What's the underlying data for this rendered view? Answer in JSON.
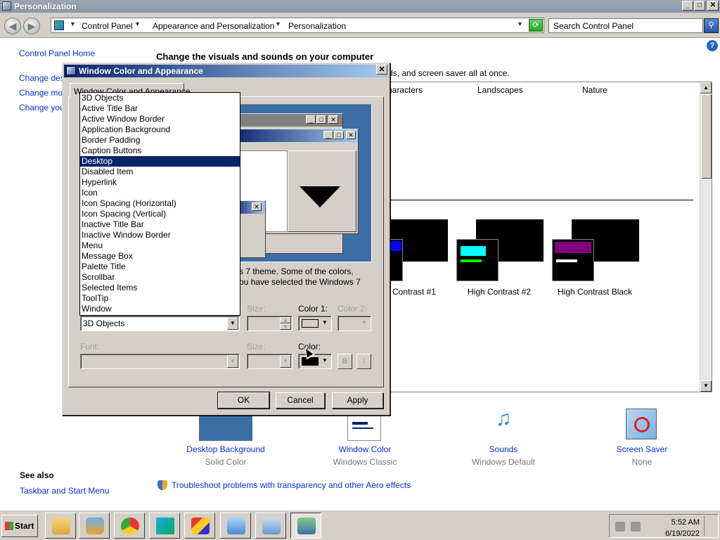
{
  "window": {
    "title": "Personalization",
    "min": "_",
    "max": "□",
    "close": "✕"
  },
  "address": {
    "crumbs": [
      "Control Panel",
      "Appearance and Personalization",
      "Personalization"
    ],
    "back": "◀",
    "forward": "▶",
    "search_placeholder": "Search Control Panel"
  },
  "left_nav": {
    "home": "Control Panel Home",
    "links": [
      "Change desk",
      "Change mou",
      "Change your"
    ]
  },
  "main": {
    "heading": "Change the visuals and sounds on your computer",
    "subheading": "ds, and screen saver all at once.",
    "help": "?"
  },
  "themes": {
    "categories": [
      "haracters",
      "Landscapes",
      "Nature"
    ],
    "items": [
      {
        "label": "Contrast #1",
        "accent": "#0000ff",
        "bar2": ""
      },
      {
        "label": "High Contrast #2",
        "accent": "#00ffff",
        "bar2": "#00ff00"
      },
      {
        "label": "High Contrast Black",
        "accent": "#800080",
        "bar2": "#ffffff"
      }
    ]
  },
  "bottom": {
    "items": [
      {
        "label": "Desktop Background",
        "sub": "Solid Color"
      },
      {
        "label": "Window Color",
        "sub": "Windows Classic"
      },
      {
        "label": "Sounds",
        "sub": "Windows Default"
      },
      {
        "label": "Screen Saver",
        "sub": "None"
      }
    ],
    "see_also": "See also",
    "taskbar_link": "Taskbar and Start Menu",
    "troubleshoot": "Troubleshoot problems with transparency and other Aero effects"
  },
  "dialog": {
    "title": "Window Color and Appearance",
    "close": "✕",
    "tab": "Window Color and Appearance",
    "desc_line1": "s 7 theme.  Some of the colors,",
    "desc_line2": "ou have selected the Windows 7",
    "item_value": "3D Objects",
    "size_label": "Size:",
    "color1_label": "Color 1:",
    "color2_label": "Color 2:",
    "font_label": "Font:",
    "font_size_label": "Size:",
    "font_color_label": "Color:",
    "bold": "B",
    "italic": "I",
    "ok": "OK",
    "cancel": "Cancel",
    "apply": "Apply"
  },
  "dropdown": {
    "options": [
      "3D Objects",
      "Active Title Bar",
      "Active Window Border",
      "Application Background",
      "Border Padding",
      "Caption Buttons",
      "Desktop",
      "Disabled Item",
      "Hyperlink",
      "Icon",
      "Icon Spacing (Horizontal)",
      "Icon Spacing (Vertical)",
      "Inactive Title Bar",
      "Inactive Window Border",
      "Menu",
      "Message Box",
      "Palette Title",
      "Scrollbar",
      "Selected Items",
      "ToolTip",
      "Window"
    ],
    "selected": "Desktop"
  },
  "taskbar": {
    "start": "Start",
    "time": "5:52 AM",
    "date": "6/19/2022"
  },
  "colors": {
    "desktop_blue": "#3a6ea5",
    "selection": "#0a246a",
    "link": "#0033cc"
  }
}
